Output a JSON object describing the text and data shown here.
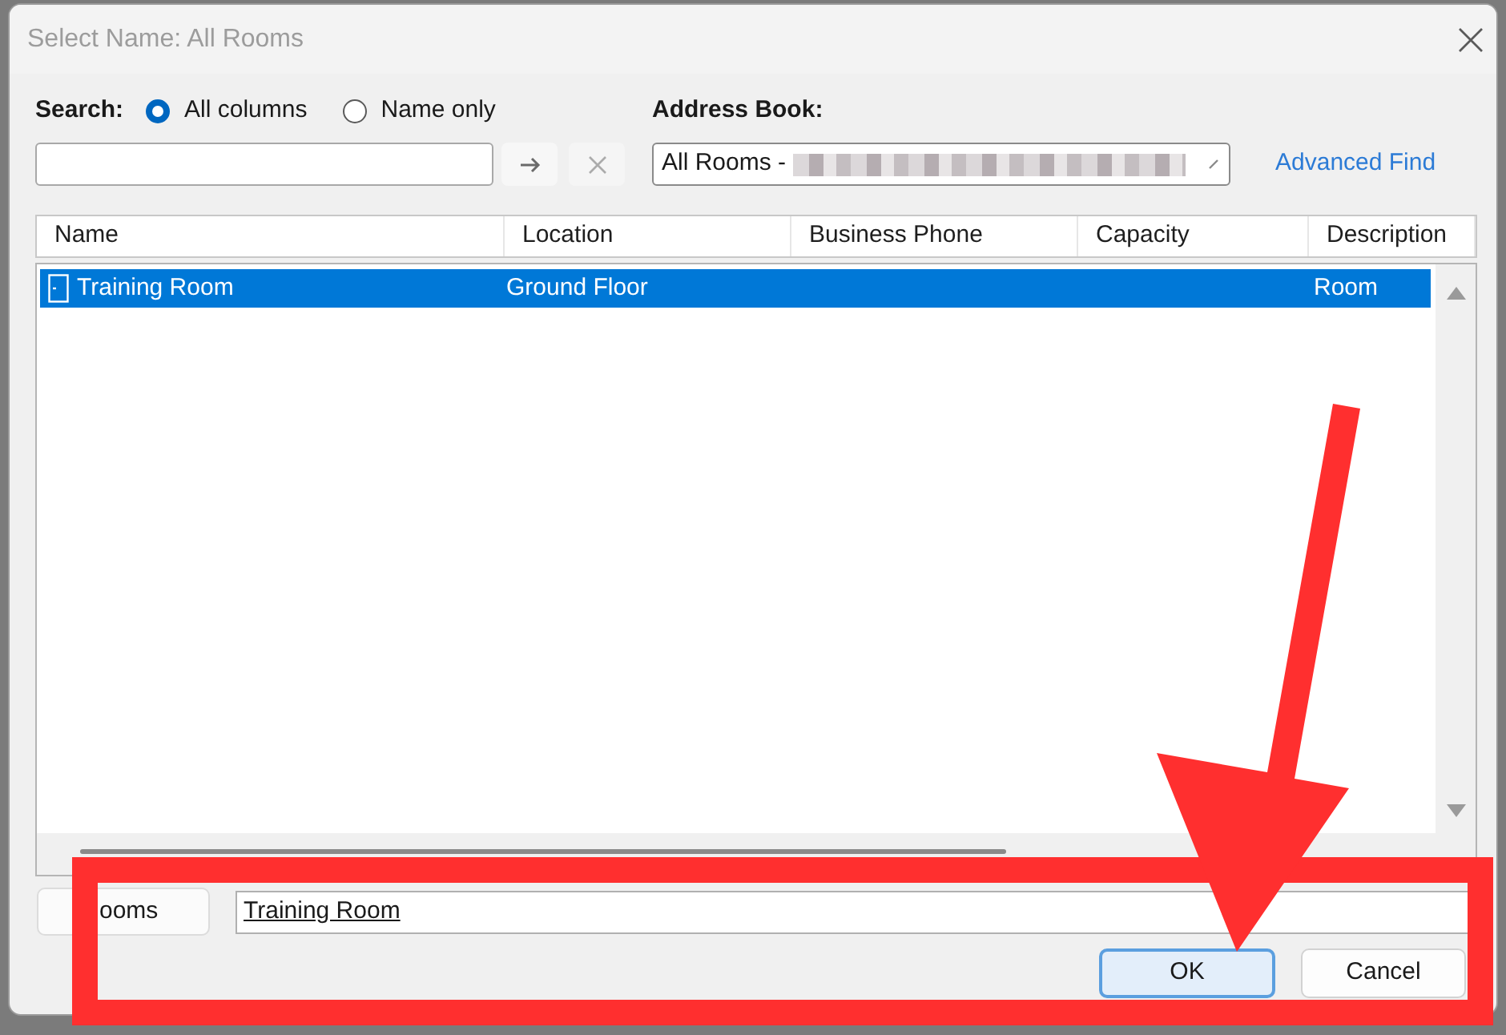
{
  "window": {
    "title": "Select Name: All Rooms"
  },
  "search": {
    "label": "Search:",
    "options": [
      {
        "label": "All columns",
        "selected": true
      },
      {
        "label": "Name only",
        "selected": false
      }
    ]
  },
  "address_book": {
    "label": "Address Book:",
    "value": "All Rooms -"
  },
  "advanced_find": {
    "label": "Advanced Find"
  },
  "table": {
    "columns": [
      "Name",
      "Location",
      "Business Phone",
      "Capacity",
      "Description"
    ],
    "rows": [
      {
        "name": "Training Room",
        "location": "Ground Floor",
        "description": "Room",
        "selected": true
      }
    ]
  },
  "selection": {
    "button": "ooms",
    "value": "Training Room"
  },
  "buttons": [
    {
      "label": "OK",
      "kind": "default"
    },
    {
      "label": "Cancel",
      "kind": "normal"
    }
  ]
}
